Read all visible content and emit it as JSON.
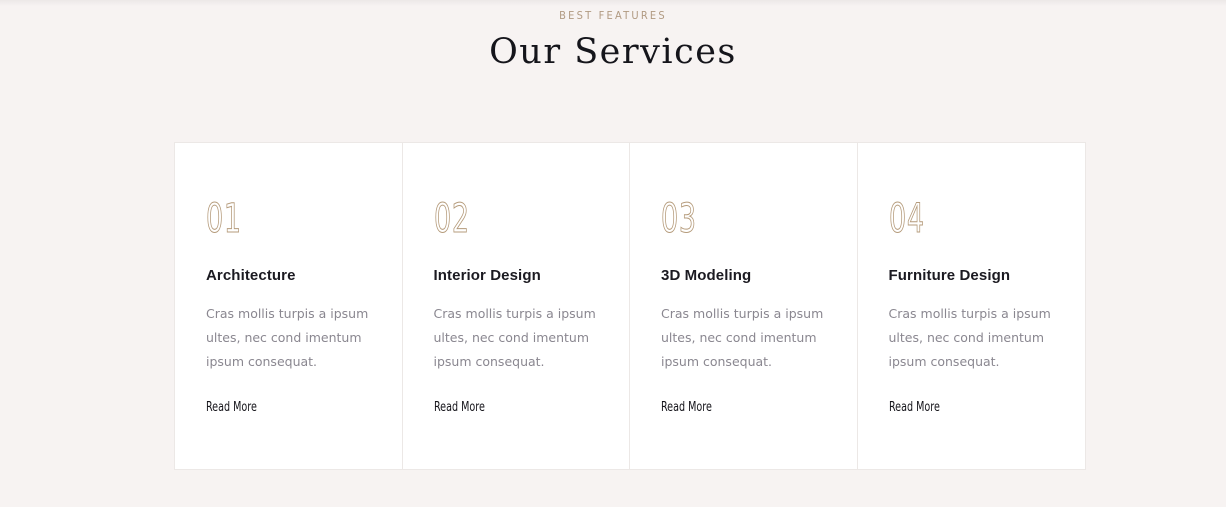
{
  "section": {
    "eyebrow": "BEST FEATURES",
    "title": "Our Services"
  },
  "colors": {
    "background": "#f7f3f2",
    "accent": "#b59b7b",
    "heading": "#15151b",
    "body_text": "#8a8790"
  },
  "services": [
    {
      "number": "01",
      "title": "Architecture",
      "description": "Cras mollis turpis a ipsum ultes, nec cond imentum ipsum consequat.",
      "link": "Read More"
    },
    {
      "number": "02",
      "title": "Interior Design",
      "description": "Cras mollis turpis a ipsum ultes, nec cond imentum ipsum consequat.",
      "link": "Read More"
    },
    {
      "number": "03",
      "title": "3D Modeling",
      "description": "Cras mollis turpis a ipsum ultes, nec cond imentum ipsum consequat.",
      "link": "Read More"
    },
    {
      "number": "04",
      "title": "Furniture Design",
      "description": "Cras mollis turpis a ipsum ultes, nec cond imentum ipsum consequat.",
      "link": "Read More"
    }
  ]
}
